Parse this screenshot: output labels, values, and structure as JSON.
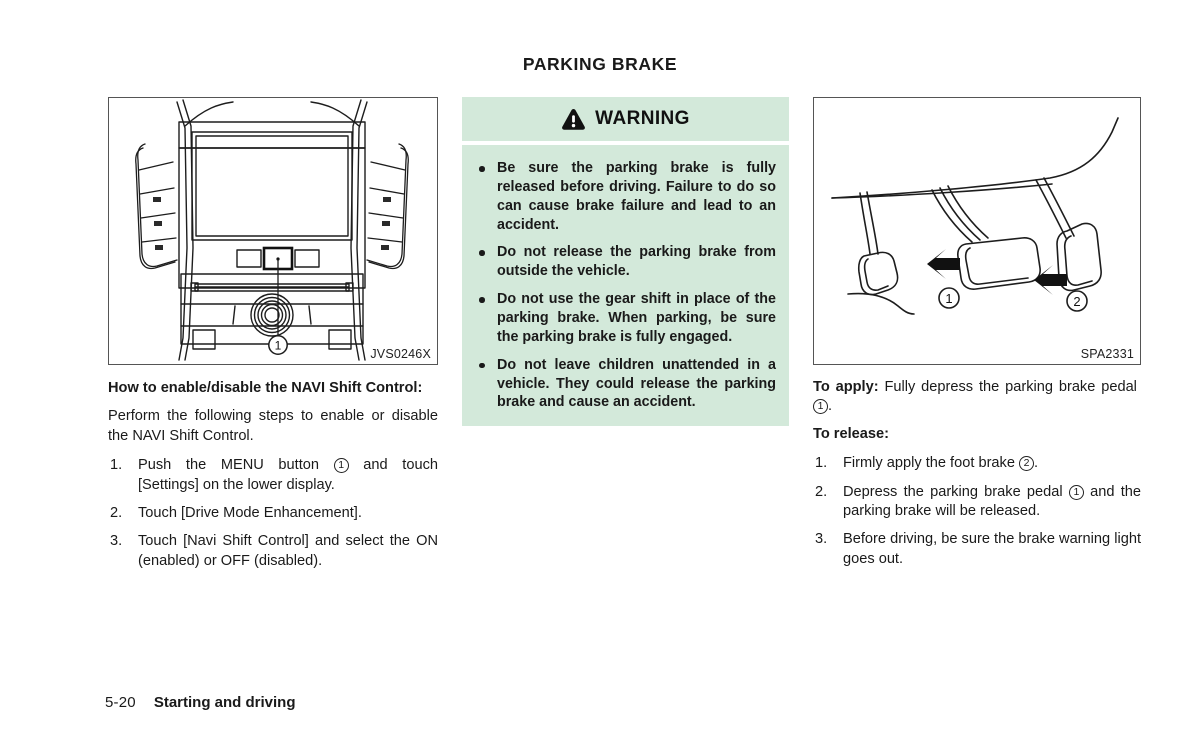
{
  "header": {
    "title": "PARKING BRAKE"
  },
  "left_column": {
    "figure": {
      "id_label": "JVS0246X",
      "callout_1": "1",
      "alt": "center console display with MENU button"
    },
    "subheading": "How to enable/disable the NAVI Shift Control:",
    "paragraph": "Perform the following steps to enable or disable the NAVI Shift Control.",
    "steps": [
      {
        "num": "1.",
        "text_before": "Push the MENU button",
        "circled": "1",
        "text_after": "and touch [Settings] on the lower display."
      },
      {
        "num": "2.",
        "text_before": "Touch [Drive Mode Enhancement].",
        "circled": "",
        "text_after": ""
      },
      {
        "num": "3.",
        "text_before": "Touch [Navi Shift Control] and select the ON (enabled) or OFF (disabled).",
        "circled": "",
        "text_after": ""
      }
    ]
  },
  "warning": {
    "title": "WARNING",
    "icon": "warning-triangle-icon",
    "background_color": "#d3e9da",
    "bullets": [
      "Be sure the parking brake is fully released before driving. Failure to do so can cause brake failure and lead to an accident.",
      "Do not release the parking brake from outside the vehicle.",
      "Do not use the gear shift in place of the parking brake. When parking, be sure the parking brake is fully engaged.",
      "Do not leave children unattended in a vehicle. They could release the parking brake and cause an accident."
    ]
  },
  "right_column": {
    "figure": {
      "id_label": "SPA2331",
      "callout_1": "1",
      "callout_2": "2",
      "alt": "parking brake pedal and foot brake pedal"
    },
    "apply_label": "To apply:",
    "apply_text_before": "Fully depress the parking brake pedal",
    "apply_circled": "1",
    "apply_text_after": ".",
    "release_label": "To release:",
    "steps": [
      {
        "num": "1.",
        "text_before": "Firmly apply the foot brake",
        "circled": "2",
        "text_after": "."
      },
      {
        "num": "2.",
        "text_before": "Depress the parking brake pedal",
        "circled": "1",
        "text_after": "and the parking brake will be released."
      },
      {
        "num": "3.",
        "text_before": "Before driving, be sure the brake warning light goes out.",
        "circled": "",
        "text_after": ""
      }
    ]
  },
  "footer": {
    "page_number": "5-20",
    "section": "Starting and driving"
  }
}
